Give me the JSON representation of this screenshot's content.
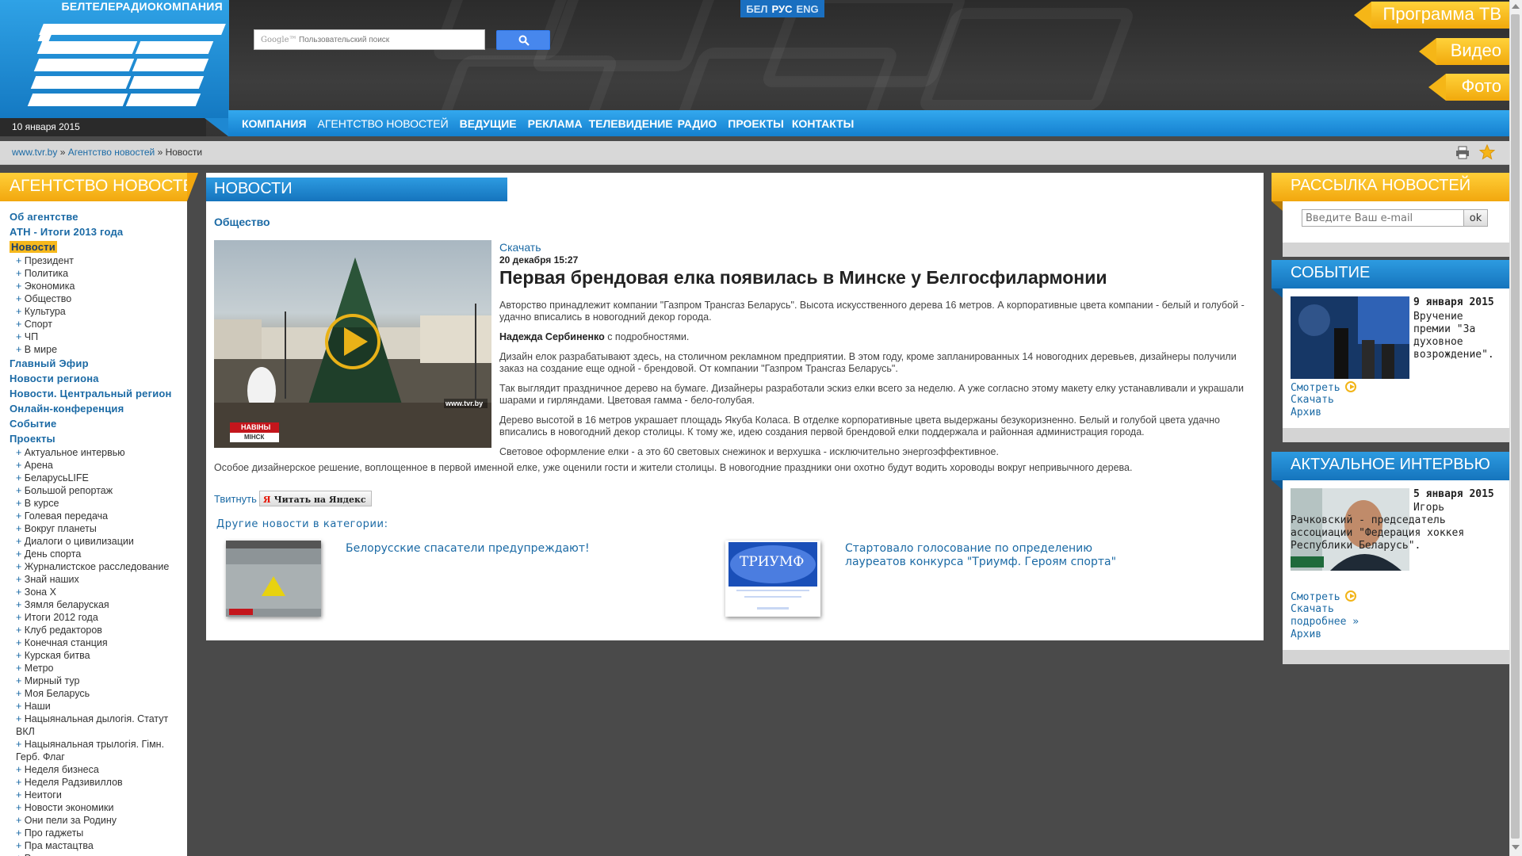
{
  "header": {
    "brand": "БЕЛТЕЛЕРАДИОКОМПАНИЯ",
    "date": "10 января 2015",
    "search_placeholder": "Пользовательский поиск",
    "search_brand": "Google™",
    "languages": [
      "БЕЛ",
      "РУС",
      "ENG"
    ],
    "side_tabs": [
      "Программа ТВ",
      "Видео",
      "Фото"
    ],
    "nav": [
      "КОМПАНИЯ",
      "АГЕНТСТВО НОВОСТЕЙ",
      "ВЕДУЩИЕ",
      "РЕКЛАМА",
      "ТЕЛЕВИДЕНИЕ",
      "РАДИО",
      "ПРОЕКТЫ",
      "КОНТАКТЫ"
    ]
  },
  "breadcrumb": {
    "home": "www.tvr.by",
    "sep": "»",
    "section": "Агентство новостей",
    "current": "Новости"
  },
  "left": {
    "title": "АГЕНТСТВО НОВОСТЕЙ",
    "menu": [
      {
        "label": "Об агентстве",
        "type": "top"
      },
      {
        "label": "АТН - Итоги 2013 года",
        "type": "top"
      },
      {
        "label": "Новости",
        "type": "top",
        "active": true
      },
      {
        "label": "Президент",
        "type": "sub"
      },
      {
        "label": "Политика",
        "type": "sub"
      },
      {
        "label": "Экономика",
        "type": "sub"
      },
      {
        "label": "Общество",
        "type": "sub"
      },
      {
        "label": "Культура",
        "type": "sub"
      },
      {
        "label": "Спорт",
        "type": "sub"
      },
      {
        "label": "ЧП",
        "type": "sub"
      },
      {
        "label": "В мире",
        "type": "sub"
      },
      {
        "label": "Главный Эфир",
        "type": "top"
      },
      {
        "label": "Новости региона",
        "type": "top"
      },
      {
        "label": "Новости. Центральный регион",
        "type": "top"
      },
      {
        "label": "Онлайн-конференция",
        "type": "top"
      },
      {
        "label": "Событие",
        "type": "top"
      },
      {
        "label": "Проекты",
        "type": "top"
      },
      {
        "label": "Актуальное интервью",
        "type": "sub"
      },
      {
        "label": "Арена",
        "type": "sub"
      },
      {
        "label": "БеларусьLIFE",
        "type": "sub"
      },
      {
        "label": "Большой репортаж",
        "type": "sub"
      },
      {
        "label": "В курсе",
        "type": "sub"
      },
      {
        "label": "Голевая передача",
        "type": "sub"
      },
      {
        "label": "Вокруг планеты",
        "type": "sub"
      },
      {
        "label": "Диалоги о цивилизации",
        "type": "sub"
      },
      {
        "label": "День спорта",
        "type": "sub"
      },
      {
        "label": "Журналистское расследование",
        "type": "sub"
      },
      {
        "label": "Знай наших",
        "type": "sub"
      },
      {
        "label": "Зона Х",
        "type": "sub"
      },
      {
        "label": "Зямля беларуская",
        "type": "sub"
      },
      {
        "label": "Итоги 2012 года",
        "type": "sub"
      },
      {
        "label": "Клуб редакторов",
        "type": "sub"
      },
      {
        "label": "Конечная станция",
        "type": "sub"
      },
      {
        "label": "Курская битва",
        "type": "sub"
      },
      {
        "label": "Метро",
        "type": "sub"
      },
      {
        "label": "Мирный тур",
        "type": "sub"
      },
      {
        "label": "Моя Беларусь",
        "type": "sub"
      },
      {
        "label": "Наши",
        "type": "sub"
      },
      {
        "label": "Нацыянальная дылогія. Статут ВКЛ",
        "type": "sub"
      },
      {
        "label": "Нацыянальная трылогія. Гімн. Герб. Флаг",
        "type": "sub"
      },
      {
        "label": "Неделя бизнеса",
        "type": "sub"
      },
      {
        "label": "Неделя Радзивиллов",
        "type": "sub"
      },
      {
        "label": "Неитоги",
        "type": "sub"
      },
      {
        "label": "Новости экономики",
        "type": "sub"
      },
      {
        "label": "Они пели за Родину",
        "type": "sub"
      },
      {
        "label": "Про гаджеты",
        "type": "sub"
      },
      {
        "label": "Пра мастацтва",
        "type": "sub"
      },
      {
        "label": "Расследование",
        "type": "sub"
      }
    ]
  },
  "main": {
    "title": "НОВОСТИ",
    "category": "Общество",
    "download": "Скачать",
    "date": "20 декабря 15:27",
    "headline": "Первая брендовая елка появилась в Минске у Белгосфилармонии",
    "thumb_tag_1": "НАВІНЫ",
    "thumb_tag_2": "МІНСК",
    "thumb_watermark": "www.tvr.by",
    "p1": "Авторство принадлежит компании \"Газпром Трансгаз Беларусь\". Высота искусственного дерева 16 метров. А корпоративные цвета компании - белый и голубой - удачно вписались в новогодний декор города.",
    "p2_name": "Надежда Сербиненко",
    "p2_rest": " с подробностями.",
    "p3": "Дизайн елок разрабатывают здесь, на столичном рекламном предприятии. В этом году, кроме запланированных 14 новогодних деревьев, дизайнеры получили заказ на создание еще одной - брендовой. От компании \"Газпром Трансгаз Беларусь\".",
    "p4": "Так выглядит праздничное дерево на бумаге. Дизайнеры разработали эскиз елки всего за неделю. А уже согласно этому макету елку устанавливали и украшали шарами и гирляндами. Цветовая гамма - бело-голубая.",
    "p5": "Дерево высотой в 16 метров украшает площадь Якуба Коласа. В отделке корпоративные цвета выдержаны безукоризненно. Белый и голубой цвета удачно вписались в новогодний декор столицы. К тому же, идею создания первой брендовой елки поддержала и районная администрация города.",
    "p6": "Световое оформление елки - а это 60 световых снежинок и верхушка - исключительно энергоэффективное.",
    "p7": "Особое дизайнерское решение, воплощенное в первой именной елке, уже оценили гости и жители столицы. В новогодние праздники они охотно будут водить хороводы вокруг непривычного дерева.",
    "tweet": "Твитнуть",
    "yandex": "Читать на Яндекс",
    "yandex_letter": "Я",
    "other_head": "Другие новости в категории:",
    "related": [
      {
        "title": "Белорусские спасатели предупреждают!"
      },
      {
        "title": "Стартовало голосование по определению лауреатов конкурса \"Триумф. Героям спорта\""
      }
    ],
    "triumph_word": "ТРИУМФ"
  },
  "right": {
    "newsletter_title": "РАССЫЛКА НОВОСТЕЙ",
    "email_placeholder": "Введите Ваш e-mail",
    "ok_label": "ok",
    "event_title": "СОБЫТИЕ",
    "event_date": "9 января 2015",
    "event_text": "Вручение премии \"За духовное возрождение\".",
    "watch": "Смотреть",
    "download": "Скачать",
    "archive": "Архив",
    "interview_title": "АКТУАЛЬНОЕ ИНТЕРВЬЮ",
    "interview_date": "5 января 2015",
    "interview_text": "Игорь Рачковский - председатель ассоциации \"Федерация хоккея Республики Беларусь\".",
    "more": "подробнее »"
  },
  "colors": {
    "brand_blue": "#1b8ad8",
    "accent_orange": "#f4b11a",
    "link": "#1b6aa5",
    "page_bg": "#4a4a4a"
  }
}
